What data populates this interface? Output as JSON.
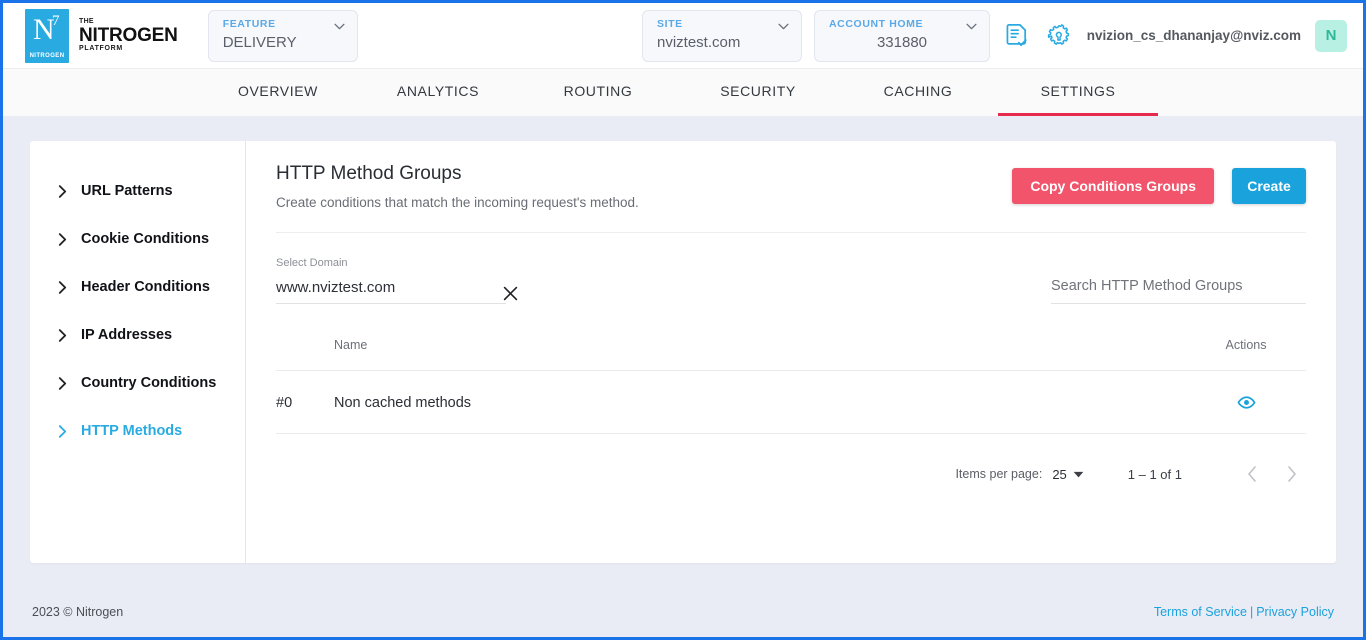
{
  "brand": {
    "badge_letter": "N",
    "badge_sup": "7",
    "badge_word": "NITROGEN",
    "the": "THE",
    "name": "NITROGEN",
    "platform": "PLATFORM"
  },
  "header": {
    "feature": {
      "label": "FEATURE",
      "value": "DELIVERY"
    },
    "site": {
      "label": "SITE",
      "value": "nviztest.com"
    },
    "account": {
      "label": "ACCOUNT HOME",
      "value": "331880"
    },
    "report_icon": "document-check-icon",
    "settings_icon": "gear-wrench-icon",
    "user_email": "nvizion_cs_dhananjay@nviz.com",
    "avatar_initial": "N",
    "accent_blue": "#29abe2",
    "avatar_bg": "#b9f0e4"
  },
  "nav": {
    "tabs": [
      {
        "label": "OVERVIEW",
        "active": false
      },
      {
        "label": "ANALYTICS",
        "active": false
      },
      {
        "label": "ROUTING",
        "active": false
      },
      {
        "label": "SECURITY",
        "active": false
      },
      {
        "label": "CACHING",
        "active": false
      },
      {
        "label": "SETTINGS",
        "active": true
      }
    ],
    "active_indicator_color": "#e8294e"
  },
  "sidebar": {
    "items": [
      {
        "label": "URL Patterns",
        "active": false
      },
      {
        "label": "Cookie Conditions",
        "active": false
      },
      {
        "label": "Header Conditions",
        "active": false
      },
      {
        "label": "IP Addresses",
        "active": false
      },
      {
        "label": "Country Conditions",
        "active": false
      },
      {
        "label": "HTTP Methods",
        "active": true
      }
    ]
  },
  "main": {
    "title": "HTTP Method Groups",
    "subtitle": "Create conditions that match the incoming request's method.",
    "buttons": {
      "copy": {
        "label": "Copy Conditions Groups",
        "color": "#f2546b"
      },
      "create": {
        "label": "Create",
        "color": "#1aa2dd"
      }
    },
    "domain_field": {
      "label": "Select Domain",
      "value": "www.nviztest.com",
      "clear_icon": "close-icon"
    },
    "search": {
      "placeholder": "Search HTTP Method Groups",
      "value": ""
    },
    "table": {
      "columns": [
        "",
        "Name",
        "Actions"
      ],
      "rows": [
        {
          "index": "#0",
          "name": "Non cached methods",
          "action_icon": "eye-icon"
        }
      ]
    },
    "pagination": {
      "items_per_page_label": "Items per page:",
      "items_per_page_value": "25",
      "range": "1 – 1 of 1",
      "prev_icon": "chevron-left-icon",
      "next_icon": "chevron-right-icon"
    }
  },
  "footer": {
    "copyright": "2023 © Nitrogen",
    "terms": "Terms of Service",
    "separator": "|",
    "privacy": "Privacy Policy"
  }
}
